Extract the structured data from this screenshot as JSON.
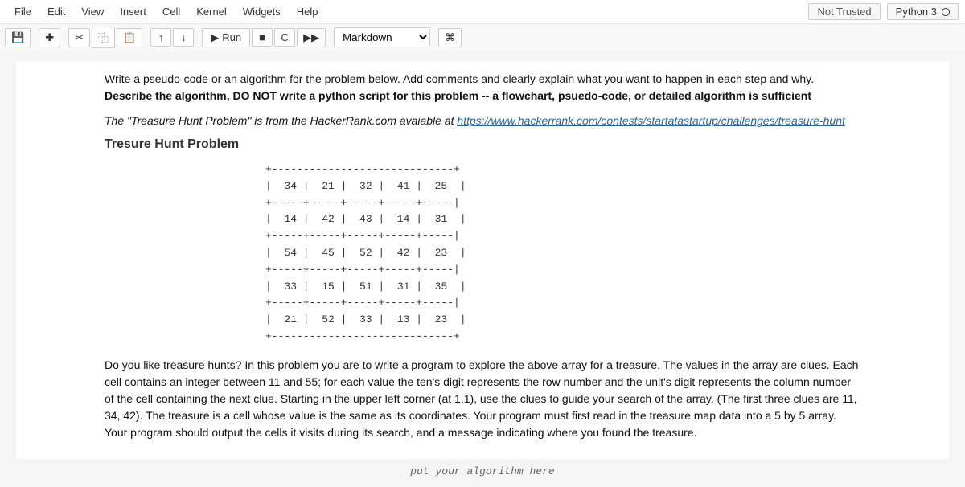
{
  "menubar": {
    "items": [
      "File",
      "Edit",
      "View",
      "Insert",
      "Cell",
      "Kernel",
      "Widgets",
      "Help"
    ],
    "not_trusted": "Not Trusted",
    "kernel": "Python 3"
  },
  "toolbar": {
    "save_icon": "💾",
    "add_icon": "✚",
    "cut_icon": "✂",
    "copy_icon": "⿻",
    "paste_icon": "📋",
    "up_icon": "↑",
    "down_icon": "↓",
    "run_icon": "▶",
    "run_label": "Run",
    "stop_icon": "■",
    "restart_icon": "C",
    "restartrun_icon": "▶▶",
    "celltype": "Markdown",
    "cmd_icon": "⌘"
  },
  "cell1": {
    "p1a": "Write a pseudo-code or an algorithm for the problem below. Add comments and clearly explain what you want to happen in each step and why. ",
    "p1b": "Describe the algorithm, DO NOT write a python script for this problem -- a flowchart, psuedo-code, or detailed algorithm is sufficient",
    "p2a": "The \"Treasure Hunt Problem\" is from the HackerRank.com avaiable at ",
    "p2link": "https://www.hackerrank.com/contests/startatastartup/challenges/treasure-hunt",
    "h3": "Tresure Hunt Problem",
    "ascii": "+-----------------------------+\n|  34 |  21 |  32 |  41 |  25  |\n+-----+-----+-----+-----+-----|\n|  14 |  42 |  43 |  14 |  31  |\n+-----+-----+-----+-----+-----|\n|  54 |  45 |  52 |  42 |  23  |\n+-----+-----+-----+-----+-----|\n|  33 |  15 |  51 |  31 |  35  |\n+-----+-----+-----+-----+-----|\n|  21 |  52 |  33 |  13 |  23  |\n+-----------------------------+",
    "p3": "Do you like treasure hunts? In this problem you are to write a program to explore the above array for a treasure. The values in the array are clues. Each cell contains an integer between 11 and 55; for each value the ten's digit represents the row number and the unit's digit represents the column number of the cell containing the next clue. Starting in the upper left corner (at 1,1), use the clues to guide your search of the array. (The first three clues are 11, 34, 42). The treasure is a cell whose value is the same as its coordinates. Your program must first read in the treasure map data into a 5 by 5 array. Your program should output the cells it visits during its search, and a message indicating where you found the treasure."
  },
  "cell2": {
    "hint": "put your algorithm here"
  }
}
